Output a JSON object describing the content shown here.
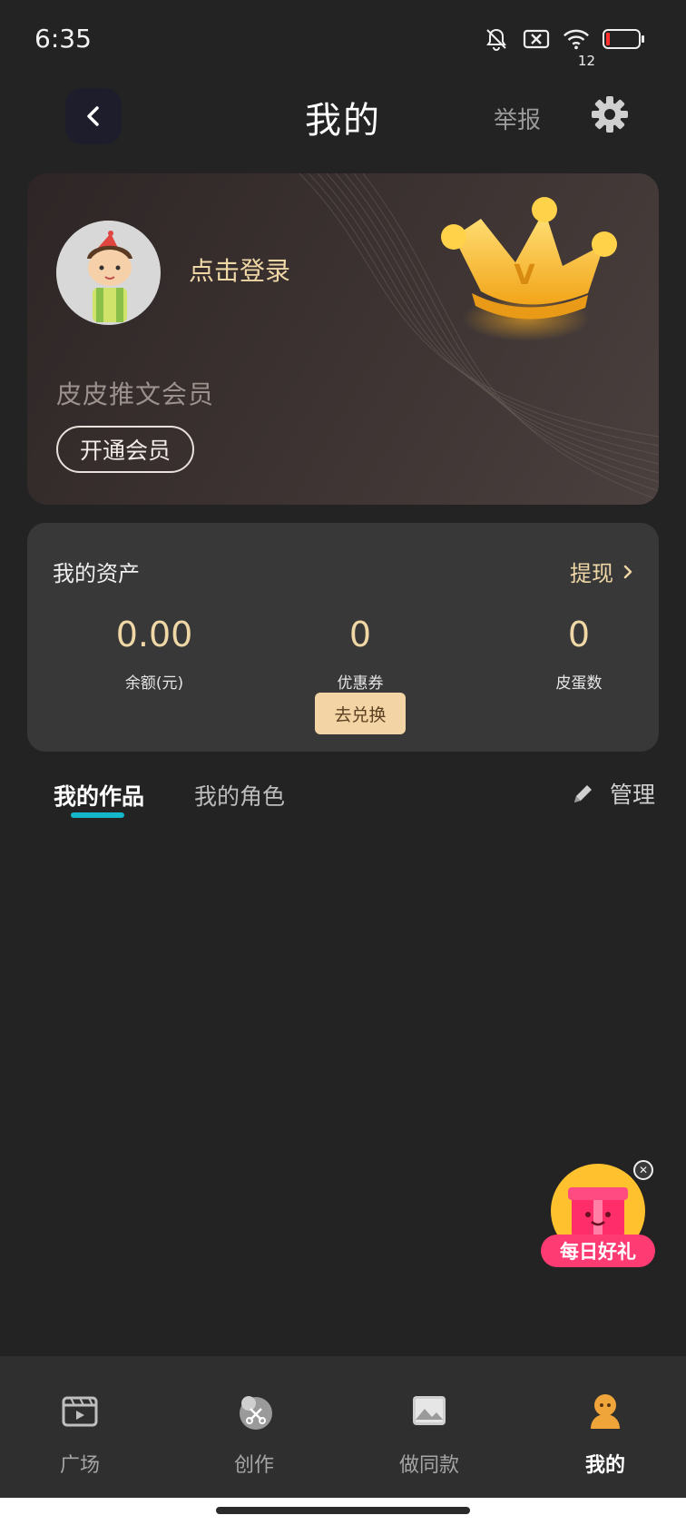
{
  "status_bar": {
    "time": "6:35",
    "battery": "12",
    "icons": [
      "bell-off-icon",
      "data-off-icon",
      "wifi-icon",
      "battery-icon"
    ]
  },
  "header": {
    "title": "我的",
    "report": "举报",
    "back_icon": "chevron-left-icon",
    "settings_icon": "gear-icon"
  },
  "vip_card": {
    "login": "点击登录",
    "name": "皮皮推文会员",
    "open_button": "开通会员",
    "crown_letter": "V"
  },
  "assets": {
    "title": "我的资产",
    "withdraw": "提现",
    "balance_value": "0.00",
    "balance_label": "余额(元)",
    "coupon_value": "0",
    "coupon_label": "优惠券",
    "exchange_button": "去兑换",
    "eggs_value": "0",
    "eggs_label": "皮蛋数"
  },
  "tabs": {
    "works": "我的作品",
    "roles": "我的角色",
    "manage": "管理"
  },
  "gift": {
    "label": "每日好礼"
  },
  "nav": {
    "square": "广场",
    "create": "创作",
    "same": "做同款",
    "mine": "我的"
  },
  "colors": {
    "background": "#232323",
    "gold_text": "#efd7a6",
    "accent_cyan": "#15b6c9",
    "gift_pink": "#ff3b74"
  }
}
